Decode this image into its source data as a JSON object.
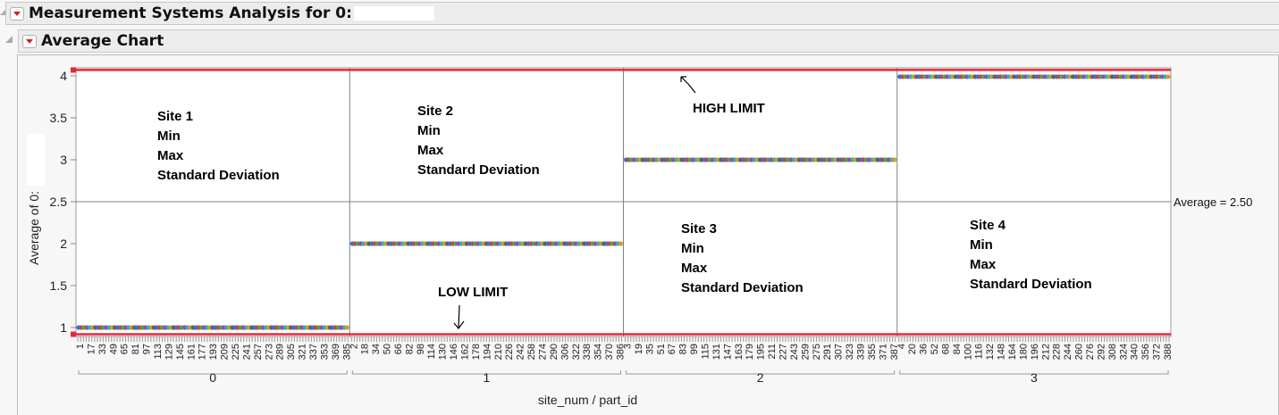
{
  "header": {
    "title": "Measurement Systems Analysis for 0:",
    "subtitle": "Average Chart"
  },
  "annotations": {
    "site1": [
      "Site 1",
      "Min",
      "Max",
      "Standard Deviation"
    ],
    "site2": [
      "Site 2",
      "Min",
      "Max",
      "Standard Deviation"
    ],
    "site3": [
      "Site 3",
      "Min",
      "Max",
      "Standard Deviation"
    ],
    "site4": [
      "Site 4",
      "Min",
      "Max",
      "Standard Deviation"
    ],
    "high_limit": "HIGH LIMIT",
    "low_limit": "LOW LIMIT"
  },
  "chart_data": {
    "type": "scatter",
    "title": "Average Chart",
    "xlabel": "site_num / part_id",
    "ylabel": "Average of 0:",
    "ylim": [
      0.9,
      4.1
    ],
    "yticks": [
      "1",
      "1.5",
      "2",
      "2.5",
      "3",
      "3.5",
      "4"
    ],
    "center_line": {
      "value": 2.5,
      "label": "Average = 2.50"
    },
    "limits": {
      "upper": 4.07,
      "lower": 0.92
    },
    "groups": [
      {
        "site_num": "0",
        "value": 1.0,
        "part_id_ticks": [
          "1",
          "17",
          "33",
          "49",
          "65",
          "81",
          "97",
          "113",
          "129",
          "145",
          "161",
          "177",
          "193",
          "209",
          "225",
          "241",
          "257",
          "273",
          "289",
          "305",
          "321",
          "337",
          "353",
          "369",
          "385"
        ]
      },
      {
        "site_num": "1",
        "value": 2.0,
        "part_id_ticks": [
          "2",
          "18",
          "34",
          "50",
          "66",
          "82",
          "98",
          "114",
          "130",
          "146",
          "162",
          "178",
          "194",
          "210",
          "226",
          "242",
          "258",
          "274",
          "290",
          "306",
          "322",
          "338",
          "354",
          "370",
          "386"
        ]
      },
      {
        "site_num": "2",
        "value": 3.0,
        "part_id_ticks": [
          "3",
          "19",
          "35",
          "51",
          "67",
          "83",
          "99",
          "115",
          "131",
          "147",
          "163",
          "179",
          "195",
          "211",
          "227",
          "243",
          "259",
          "275",
          "291",
          "307",
          "323",
          "339",
          "355",
          "371",
          "387"
        ]
      },
      {
        "site_num": "3",
        "value": 3.99,
        "part_id_ticks": [
          "4",
          "20",
          "36",
          "52",
          "68",
          "84",
          "100",
          "116",
          "132",
          "148",
          "164",
          "180",
          "196",
          "212",
          "228",
          "244",
          "260",
          "276",
          "292",
          "308",
          "324",
          "340",
          "356",
          "372",
          "388"
        ]
      }
    ],
    "colors": {
      "limit": "#e8283c",
      "grid": "#808080",
      "points": [
        "#3a6fd8",
        "#d04040",
        "#40b040",
        "#a040c0",
        "#30b0b0",
        "#d0a020",
        "#606060"
      ]
    }
  }
}
